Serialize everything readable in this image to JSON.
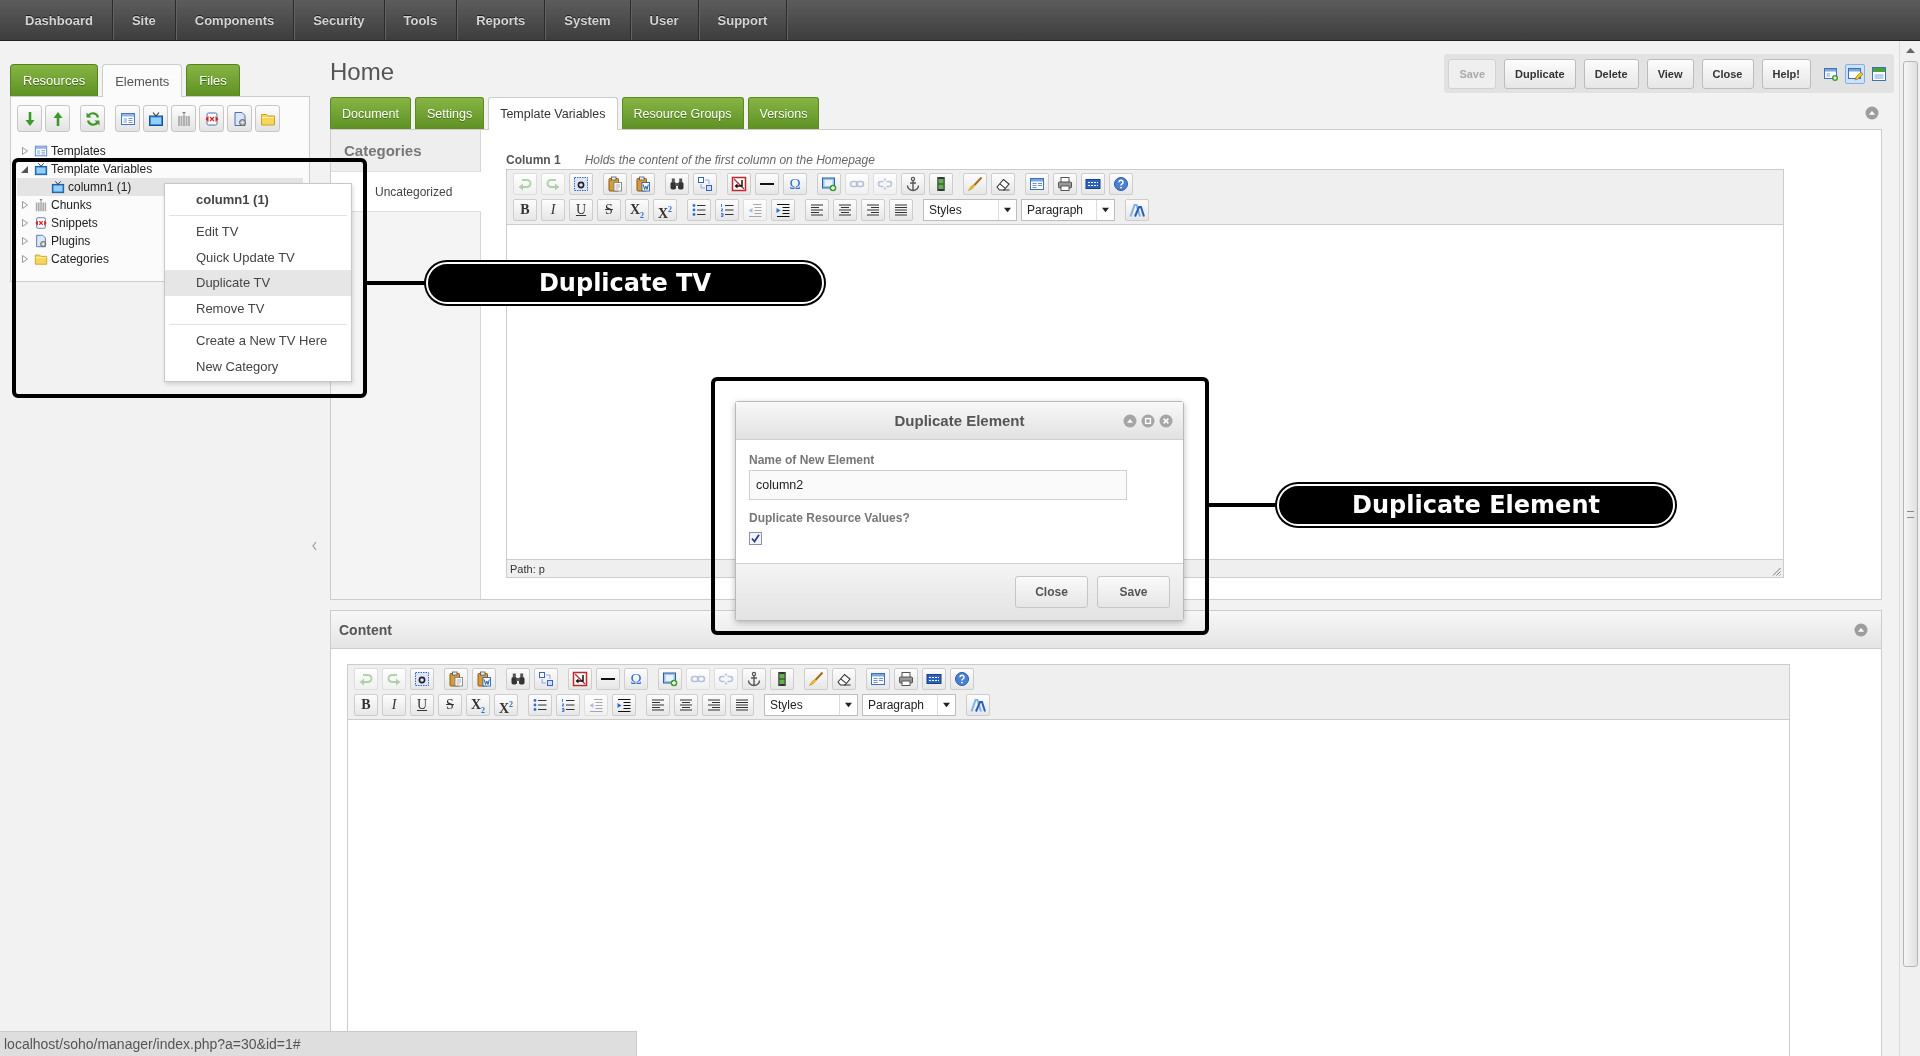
{
  "top_menu": [
    "Dashboard",
    "Site",
    "Components",
    "Security",
    "Tools",
    "Reports",
    "System",
    "User",
    "Support"
  ],
  "left_panel": {
    "tabs": [
      {
        "label": "Resources",
        "selected": false
      },
      {
        "label": "Elements",
        "selected": true
      },
      {
        "label": "Files",
        "selected": false
      }
    ],
    "tree": [
      {
        "label": "Templates",
        "expanded": false,
        "selected": false
      },
      {
        "label": "Template Variables",
        "expanded": true,
        "selected": false,
        "children": [
          {
            "label": "column1 (1)",
            "selected": true
          }
        ]
      },
      {
        "label": "Chunks",
        "expanded": false,
        "selected": false
      },
      {
        "label": "Snippets",
        "expanded": false,
        "selected": false
      },
      {
        "label": "Plugins",
        "expanded": false,
        "selected": false
      },
      {
        "label": "Categories",
        "expanded": false,
        "selected": false
      }
    ]
  },
  "context_menu": {
    "title": "column1 (1)",
    "groups": [
      [
        {
          "label": "Edit TV",
          "selected": false
        },
        {
          "label": "Quick Update TV",
          "selected": false
        },
        {
          "label": "Duplicate TV",
          "selected": true
        },
        {
          "label": "Remove TV",
          "selected": false
        }
      ],
      [
        {
          "label": "Create a New TV Here",
          "selected": false
        },
        {
          "label": "New Category",
          "selected": false
        }
      ]
    ]
  },
  "page": {
    "title": "Home",
    "actions": [
      {
        "label": "Save",
        "disabled": true
      },
      {
        "label": "Duplicate",
        "disabled": false
      },
      {
        "label": "Delete",
        "disabled": false
      },
      {
        "label": "View",
        "disabled": false
      },
      {
        "label": "Close",
        "disabled": false
      },
      {
        "label": "Help!",
        "disabled": false
      }
    ],
    "view_toggles": [
      {
        "selected": false
      },
      {
        "selected": true
      },
      {
        "selected": false
      }
    ],
    "tabs": [
      {
        "label": "Document",
        "selected": false
      },
      {
        "label": "Settings",
        "selected": false
      },
      {
        "label": "Template Variables",
        "selected": true
      },
      {
        "label": "Resource Groups",
        "selected": false
      },
      {
        "label": "Versions",
        "selected": false
      }
    ]
  },
  "tv_panel": {
    "categories_heading": "Categories",
    "categories": [
      {
        "label": "Uncategorized",
        "selected": true
      }
    ],
    "fields": [
      {
        "label": "Column 1",
        "description": "Holds the content of the first column on the Homepage",
        "editor": {
          "toolbar_rows": [
            [
              [
                {
                  "kind": "icon",
                  "disabled": true
                },
                {
                  "kind": "icon",
                  "disabled": true
                },
                {
                  "kind": "icon",
                  "disabled": false
                }
              ],
              [
                {
                  "kind": "icon",
                  "disabled": false
                },
                {
                  "kind": "icon",
                  "disabled": false
                }
              ],
              [
                {
                  "kind": "icon",
                  "disabled": false
                },
                {
                  "kind": "icon",
                  "disabled": false
                }
              ],
              [
                {
                  "kind": "icon",
                  "disabled": false
                },
                {
                  "kind": "icon",
                  "disabled": false
                },
                {
                  "kind": "symbol",
                  "label": "Ω",
                  "disabled": false
                }
              ],
              [
                {
                  "kind": "icon",
                  "disabled": false
                },
                {
                  "kind": "icon",
                  "disabled": true
                },
                {
                  "kind": "icon",
                  "disabled": true
                },
                {
                  "kind": "icon",
                  "disabled": false
                },
                {
                  "kind": "icon",
                  "disabled": false
                }
              ],
              [
                {
                  "kind": "icon",
                  "disabled": false
                },
                {
                  "kind": "icon",
                  "disabled": false
                }
              ],
              [
                {
                  "kind": "icon",
                  "disabled": false
                },
                {
                  "kind": "icon",
                  "disabled": false
                },
                {
                  "kind": "icon",
                  "disabled": false
                },
                {
                  "kind": "icon",
                  "disabled": false
                }
              ]
            ],
            [
              [
                {
                  "kind": "bold",
                  "label": "B",
                  "disabled": false
                },
                {
                  "kind": "italic",
                  "label": "I",
                  "disabled": false
                },
                {
                  "kind": "underline",
                  "label": "U",
                  "disabled": false
                },
                {
                  "kind": "strike",
                  "label": "S",
                  "disabled": false
                },
                {
                  "kind": "script",
                  "label": "X$_{2}$",
                  "disabled": false
                },
                {
                  "kind": "script",
                  "label": "X$^{2}$",
                  "disabled": false
                }
              ],
              [
                {
                  "kind": "icon",
                  "disabled": false
                },
                {
                  "kind": "icon",
                  "disabled": false
                },
                {
                  "kind": "icon",
                  "disabled": true
                },
                {
                  "kind": "icon",
                  "disabled": false
                }
              ],
              [
                {
                  "kind": "icon",
                  "disabled": false
                },
                {
                  "kind": "icon",
                  "disabled": false
                },
                {
                  "kind": "icon",
                  "disabled": false
                },
                {
                  "kind": "icon",
                  "disabled": false
                }
              ],
              [
                {
                  "kind": "dropdown",
                  "label": "Styles",
                  "disabled": false
                },
                {
                  "kind": "dropdown",
                  "label": "Paragraph",
                  "disabled": false
                }
              ],
              [
                {
                  "kind": "icon",
                  "disabled": false
                }
              ]
            ]
          ],
          "path": "Path: p"
        }
      }
    ]
  },
  "content_panel": {
    "title": "Content",
    "editor": {
      "toolbar_rows": [
        [
          [
            {
              "kind": "icon",
              "disabled": true
            },
            {
              "kind": "icon",
              "disabled": true
            },
            {
              "kind": "icon",
              "disabled": false
            }
          ],
          [
            {
              "kind": "icon",
              "disabled": false
            },
            {
              "kind": "icon",
              "disabled": false
            }
          ],
          [
            {
              "kind": "icon",
              "disabled": false
            },
            {
              "kind": "icon",
              "disabled": false
            }
          ],
          [
            {
              "kind": "icon",
              "disabled": false
            },
            {
              "kind": "icon",
              "disabled": false
            },
            {
              "kind": "symbol",
              "label": "Ω",
              "disabled": false
            }
          ],
          [
            {
              "kind": "icon",
              "disabled": false
            },
            {
              "kind": "icon",
              "disabled": true
            },
            {
              "kind": "icon",
              "disabled": true
            },
            {
              "kind": "icon",
              "disabled": false
            },
            {
              "kind": "icon",
              "disabled": false
            }
          ],
          [
            {
              "kind": "icon",
              "disabled": false
            },
            {
              "kind": "icon",
              "disabled": false
            }
          ],
          [
            {
              "kind": "icon",
              "disabled": false
            },
            {
              "kind": "icon",
              "disabled": false
            },
            {
              "kind": "icon",
              "disabled": false
            },
            {
              "kind": "icon",
              "disabled": false
            }
          ]
        ],
        [
          [
            {
              "kind": "bold",
              "label": "B",
              "disabled": false
            },
            {
              "kind": "italic",
              "label": "I",
              "disabled": false
            },
            {
              "kind": "underline",
              "label": "U",
              "disabled": false
            },
            {
              "kind": "strike",
              "label": "S",
              "disabled": false
            },
            {
              "kind": "script",
              "label": "X$_{2}$",
              "disabled": false
            },
            {
              "kind": "script",
              "label": "X$^{2}$",
              "disabled": false
            }
          ],
          [
            {
              "kind": "icon",
              "disabled": false
            },
            {
              "kind": "icon",
              "disabled": false
            },
            {
              "kind": "icon",
              "disabled": true
            },
            {
              "kind": "icon",
              "disabled": false
            }
          ],
          [
            {
              "kind": "icon",
              "disabled": false
            },
            {
              "kind": "icon",
              "disabled": false
            },
            {
              "kind": "icon",
              "disabled": false
            },
            {
              "kind": "icon",
              "disabled": false
            }
          ],
          [
            {
              "kind": "dropdown",
              "label": "Styles",
              "disabled": false
            },
            {
              "kind": "dropdown",
              "label": "Paragraph",
              "disabled": false
            }
          ],
          [
            {
              "kind": "icon",
              "disabled": false
            }
          ]
        ]
      ]
    }
  },
  "dialog": {
    "title": "Duplicate Element",
    "fields": [
      {
        "kind": "text",
        "label": "Name of New Element",
        "value": "column2"
      },
      {
        "kind": "checkbox",
        "label": "Duplicate Resource Values?",
        "checked": true
      }
    ],
    "buttons": [
      {
        "label": "Close"
      },
      {
        "label": "Save"
      }
    ]
  },
  "annotations": [
    {
      "label": "Duplicate TV"
    },
    {
      "label": "Duplicate Element"
    }
  ],
  "status_url": "localhost/soho/manager/index.php?a=30&id=1#"
}
